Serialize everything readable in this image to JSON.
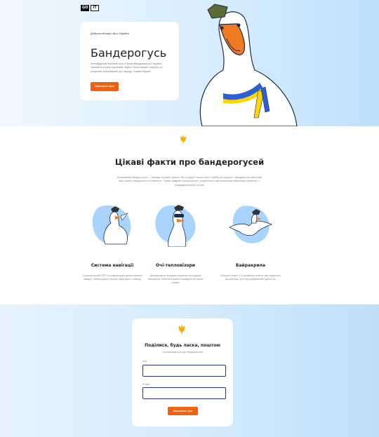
{
  "brand": {
    "logo_left": "GO",
    "logo_right": "IT"
  },
  "hero": {
    "eyebrow": "Доброго вечора, ми з України",
    "title": "Бандерогусь",
    "text": "Легендарний бойовий гусь із Волинбандерівської України. Тримає в страху окупантів. Вірно і безстрашно служить та охороняє незалежний рух народу. Слава Україні!",
    "button": "Замовити гуся"
  },
  "facts": {
    "title": "Цікаві факти про бандерогусей",
    "description": "Безмежний бандерогусь — завжди на варті країни. Він у рядах тисячі несе службу на кордоні, наводячи на окупантів жах своєю поведінкою та стійкістю. Також завдяки спеціальності, розроблені заклинаннями неймовірні навички, з' розвідувальними стрем.",
    "items": [
      {
        "title": "Система навігації",
        "text": "Суперсучасний GPS та компакторна десантовання навкруг; межну країну ігнорує свою місія з обміну."
      },
      {
        "title": "Очі-тепловізори",
        "text": "Допомагають несемаш характер на кордоні вбачатися і внесок в районі сповідати по своїм ночам."
      },
      {
        "title": "Байракрила",
        "text": "Клекуче пелює 3 Z-спрайсові ракети, які керуючися ще крилом, а не під управлінням одного ку."
      }
    ]
  },
  "form": {
    "title": "Поділися, будь ласка, поштою",
    "subtitle": "та спалахом гуся до бандерогусей",
    "name_label": "Ім'я",
    "email_label": "E-mail",
    "button": "Замовити гуся"
  },
  "colors": {
    "accent": "#f0620f",
    "input_border": "#1a3c8c",
    "goose_bg": "#a8d4fb"
  }
}
